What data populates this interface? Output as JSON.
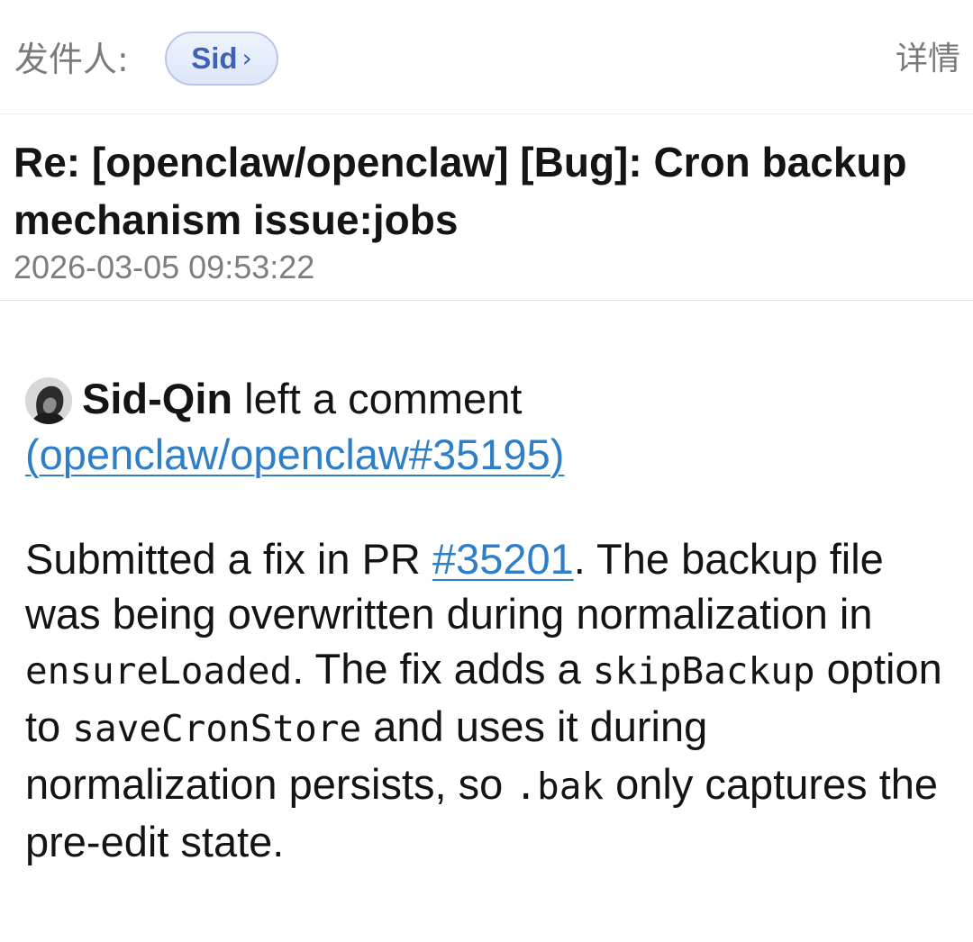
{
  "header": {
    "sender_label": "发件人:",
    "sender_name": "Sid",
    "sender_chevron": "›",
    "details_label": "详情"
  },
  "subject": {
    "title": "Re: [openclaw/openclaw] [Bug]: Cron backup mechanism issue:jobs",
    "date": "2026-03-05 09:53:22"
  },
  "comment": {
    "author": "Sid-Qin",
    "action": "left a comment",
    "issue_ref": "(openclaw/openclaw#35195)",
    "body": {
      "t1": "Submitted a fix in PR ",
      "pr_link": "#35201",
      "t2": ". The backup file was being overwritten during normalization in ",
      "c1": "ensureLoaded",
      "t3": ". The fix adds a ",
      "c2": "skipBackup",
      "t4": " option to ",
      "c3": "saveCronStore",
      "t5": " and uses it during normalization persists, so ",
      "c4": ".bak",
      "t6": " only captures the pre-edit state."
    }
  },
  "colors": {
    "link": "#2f7ec8",
    "chip_text": "#3f61b6",
    "muted": "#7a7a7a"
  },
  "icons": {
    "avatar": "avatar-image",
    "chip": "chevron-right-icon"
  }
}
